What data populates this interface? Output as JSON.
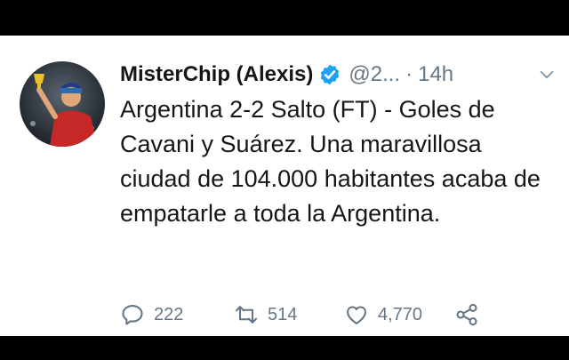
{
  "tweet": {
    "display_name": "MisterChip (Alexis)",
    "handle": "@2...",
    "separator": "·",
    "time": "14h",
    "text": "Argentina 2-2 Salto (FT) - Goles de Cavani y Suárez. Una maravillosa ciudad de 104.000 habitantes acaba de empatarle a toda la Argentina.",
    "stats": {
      "replies": "222",
      "retweets": "514",
      "likes": "4,770"
    }
  },
  "colors": {
    "text": "#14171a",
    "secondary": "#657786",
    "verified": "#1da1f2",
    "background": "#ffffff"
  },
  "icons": [
    "verified-badge-icon",
    "chevron-down-icon",
    "reply-icon",
    "retweet-icon",
    "like-icon",
    "share-icon"
  ]
}
